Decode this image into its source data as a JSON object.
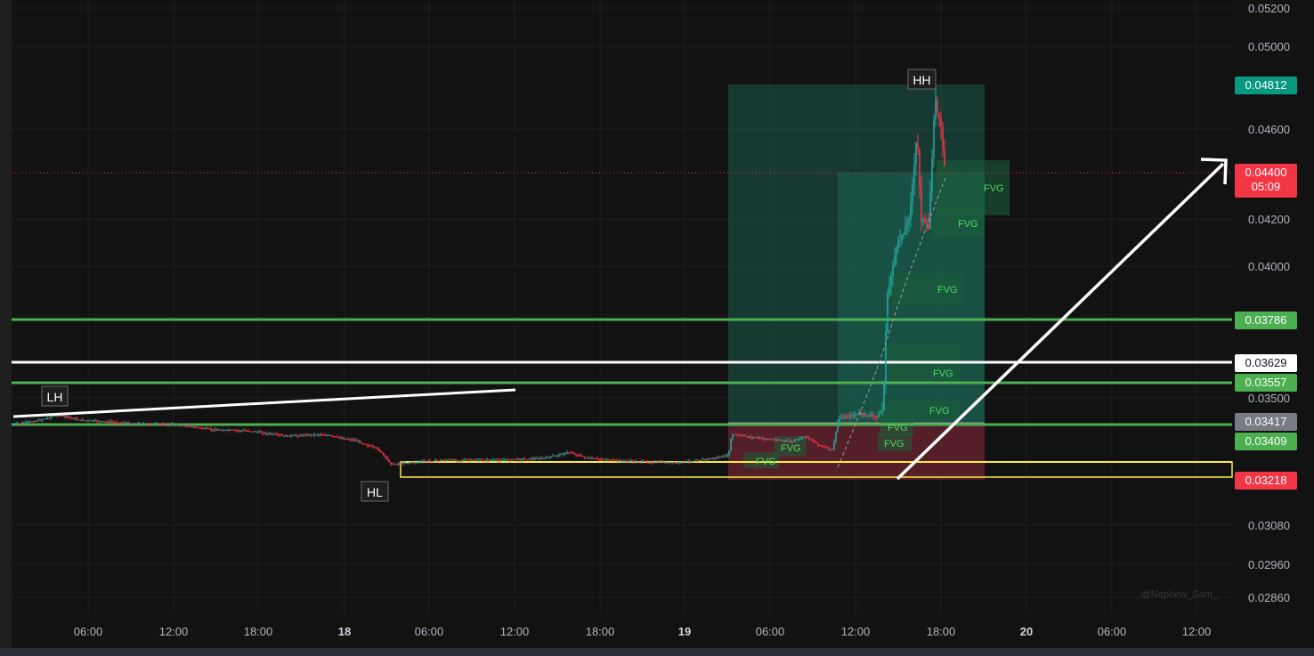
{
  "watermark": "@Nephew_Sam_",
  "price_axis": {
    "ticks": [
      "0.05200",
      "0.05000",
      "0.04600",
      "0.04200",
      "0.04000",
      "0.03500",
      "0.03080",
      "0.02960",
      "0.02860"
    ],
    "tags": [
      {
        "text": "0.04812",
        "bg": "#089981",
        "fg": "#ffffff"
      },
      {
        "text": "0.04400",
        "sub": "05:09",
        "bg": "#f23645",
        "fg": "#ffffff"
      },
      {
        "text": "0.03786",
        "bg": "#4caf50",
        "fg": "#ffffff"
      },
      {
        "text": "0.03629",
        "bg": "#ffffff",
        "fg": "#131722"
      },
      {
        "text": "0.03557",
        "bg": "#4caf50",
        "fg": "#ffffff"
      },
      {
        "text": "0.03417",
        "bg": "#787b86",
        "fg": "#ffffff"
      },
      {
        "text": "0.03409",
        "bg": "#4caf50",
        "fg": "#ffffff"
      },
      {
        "text": "0.03218",
        "bg": "#f23645",
        "fg": "#ffffff"
      }
    ]
  },
  "time_axis": {
    "labels": [
      "06:00",
      "12:00",
      "18:00",
      "18",
      "06:00",
      "12:00",
      "18:00",
      "19",
      "06:00",
      "12:00",
      "18:00",
      "20",
      "06:00",
      "12:00"
    ]
  },
  "annotations": {
    "lh": "LH",
    "hl": "HL",
    "hh": "HH",
    "fvg": [
      "FVG",
      "FVG",
      "FVG",
      "FVG",
      "FVG",
      "FVG",
      "FVG",
      "FVG",
      "FVG"
    ]
  },
  "colors": {
    "background": "#121212",
    "up": "#26a69a",
    "down": "#f23645",
    "level_green": "#4caf50",
    "level_white": "#ffffff",
    "range_yellow": "#ffeb3b"
  }
}
